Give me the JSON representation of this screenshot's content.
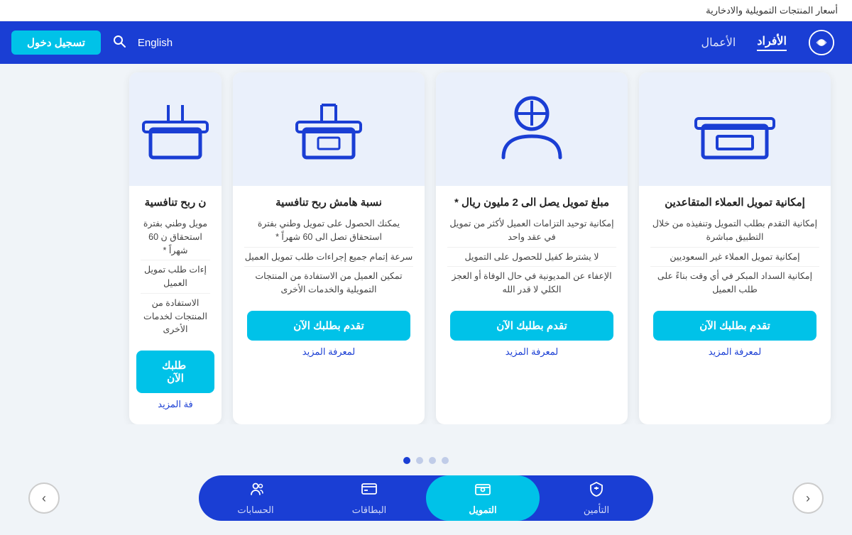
{
  "topbar": {
    "text": "أسعار المنتجات التمويلية والادخارية"
  },
  "navbar": {
    "logo_alt": "bank-logo",
    "links": [
      {
        "label": "الأفراد",
        "active": true
      },
      {
        "label": "الأعمال",
        "active": false
      }
    ],
    "english_label": "English",
    "search_label": "search",
    "login_label": "تسجيل دخول"
  },
  "cards": [
    {
      "id": "card-1",
      "icon": "desk-icon",
      "title": "إمكانية تمويل العملاء المتقاعدين",
      "features": [
        "إمكانية التقدم بطلب التمويل وتنفيذه من خلال التطبيق مباشرة",
        "إمكانية تمويل العملاء غير السعوديين",
        "إمكانية السداد المبكر في أي وقت بناءً على طلب العميل"
      ],
      "btn_label": "تقدم بطلبك الآن",
      "link_label": "لمعرفة المزيد"
    },
    {
      "id": "card-2",
      "icon": "person-icon",
      "title": "مبلغ تمويل يصل الى 2 مليون ريال *",
      "features": [
        "إمكانية توحيد التزامات العميل لأكثر من تمويل في عقد واحد",
        "لا يشترط كفيل للحصول على التمويل",
        "الإعفاء عن المديونية في حال الوفاة أو العجز الكلي لا قدر الله"
      ],
      "btn_label": "تقدم بطلبك الآن",
      "link_label": "لمعرفة المزيد"
    },
    {
      "id": "card-3",
      "icon": "chair-icon",
      "title": "نسبة هامش ربح تنافسية",
      "features": [
        "يمكنك الحصول على تمويل وطني بفترة استحقاق تصل الى 60 شهراً *",
        "سرعة إتمام جميع إجراءات طلب تمويل العميل",
        "تمكين العميل من الاستفادة من المنتجات التمويلية والخدمات الأخرى"
      ],
      "btn_label": "تقدم بطلبك الآن",
      "link_label": "لمعرفة المزيد"
    },
    {
      "id": "card-4",
      "icon": "desk2-icon",
      "title": "ن ربح تنافسية",
      "features": [
        "مويل وطني بفترة استحقاق ن 60 شهراً *",
        "إءات طلب تمويل العميل",
        "الاستفادة من المنتجات لخدمات الأخرى"
      ],
      "btn_label": "طلبك الآن",
      "link_label": "فة المزيد"
    }
  ],
  "dots": [
    {
      "active": false
    },
    {
      "active": false
    },
    {
      "active": false
    },
    {
      "active": true
    }
  ],
  "bottom_nav": {
    "items": [
      {
        "label": "التأمين",
        "icon": "insurance-icon",
        "active": false
      },
      {
        "label": "التمويل",
        "icon": "finance-icon",
        "active": true
      },
      {
        "label": "البطاقات",
        "icon": "cards-icon",
        "active": false
      },
      {
        "label": "الحسابات",
        "icon": "accounts-icon",
        "active": false
      }
    ]
  },
  "arrows": {
    "prev_label": "‹",
    "next_label": "›"
  }
}
